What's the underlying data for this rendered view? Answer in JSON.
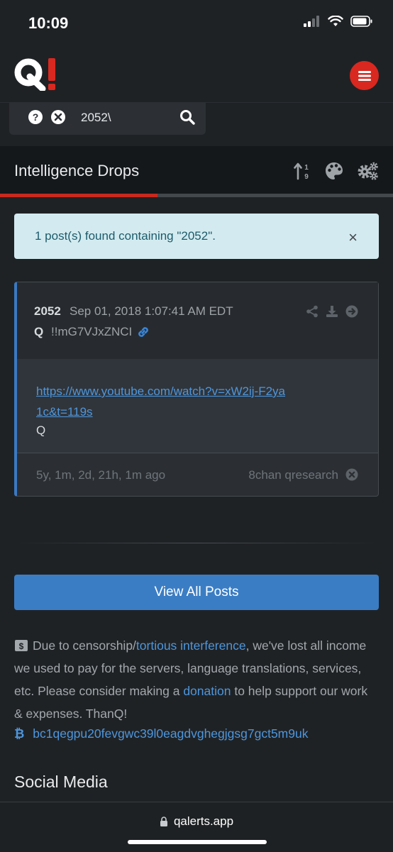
{
  "status_bar": {
    "time": "10:09"
  },
  "nav": {
    "logo_text": "Q!",
    "logo_color": "#d9281f"
  },
  "search": {
    "value": "2052\\"
  },
  "heading": {
    "title": "Intelligence Drops",
    "progress_percent": 40
  },
  "alert": {
    "message": "1 post(s) found containing \"2052\".",
    "close_symbol": "×"
  },
  "post": {
    "number": "2052",
    "date": "Sep 01, 2018 1:07:41 AM EDT",
    "author": "Q",
    "tripcode": "!!mG7VJxZNCI",
    "link": "https://www.youtube.com/watch?v=xW2ij-F2ya1c&t=119s",
    "signature": "Q",
    "age": "5y, 1m, 2d, 21h, 1m ago",
    "source": "8chan qresearch"
  },
  "buttons": {
    "view_all": "View All Posts"
  },
  "notice": {
    "part1": "Due to censorship/",
    "link1": "tortious interference",
    "part2": ", we've lost all income we used to pay for the servers, language translations, services, etc. Please consider making a ",
    "link2": "donation",
    "part3": " to help support our work & expenses. ThanQ!",
    "btc_symbol": "₿",
    "btc_address": "bc1qegpu20fevgwc39l0eagdvghegjgsg7gct5m9uk"
  },
  "social": {
    "heading": "Social Media"
  },
  "browser": {
    "url": "qalerts.app"
  }
}
